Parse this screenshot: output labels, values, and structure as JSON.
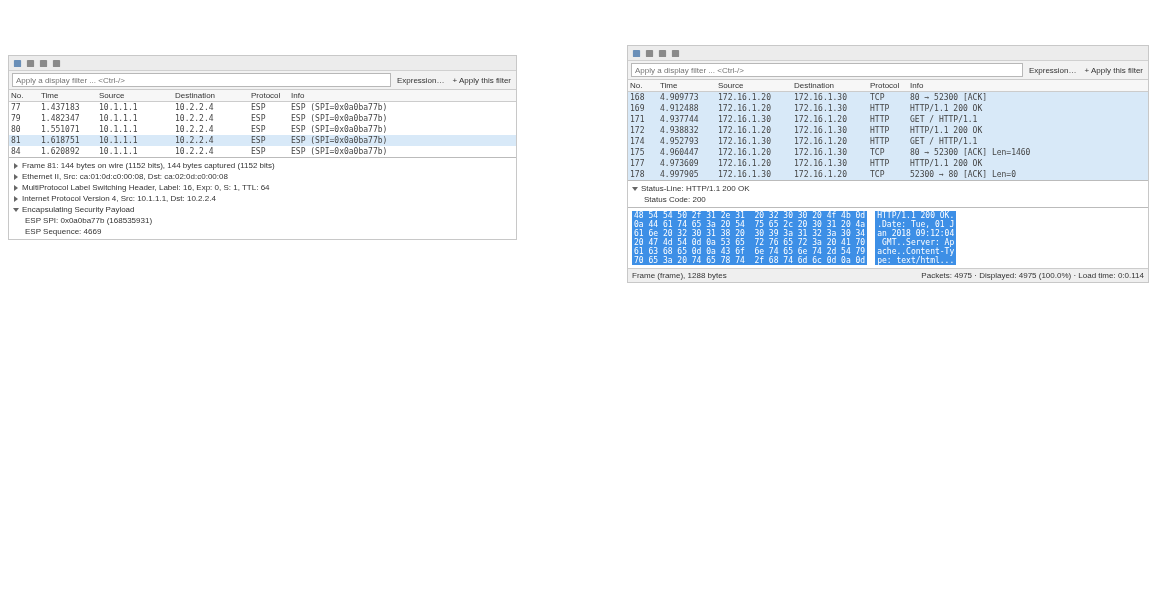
{
  "windows": [
    {
      "filter": {
        "placeholder": "Apply a display filter ... <Ctrl-/>"
      },
      "filter_buttons": [
        "Expression…",
        "+ Apply this filter"
      ],
      "columns": [
        "No.",
        "Time",
        "Source",
        "Destination",
        "Protocol",
        "Info"
      ],
      "rows": [
        {
          "no": "77",
          "time": "1.437183",
          "source": "10.1.1.1",
          "destination": "10.2.2.4",
          "protocol": "ESP",
          "info": "ESP (SPI=0x0a0ba77b)",
          "selected": false
        },
        {
          "no": "79",
          "time": "1.482347",
          "source": "10.1.1.1",
          "destination": "10.2.2.4",
          "protocol": "ESP",
          "info": "ESP (SPI=0x0a0ba77b)",
          "selected": false
        },
        {
          "no": "80",
          "time": "1.551071",
          "source": "10.1.1.1",
          "destination": "10.2.2.4",
          "protocol": "ESP",
          "info": "ESP (SPI=0x0a0ba77b)",
          "selected": false
        },
        {
          "no": "81",
          "time": "1.618751",
          "source": "10.1.1.1",
          "destination": "10.2.2.4",
          "protocol": "ESP",
          "info": "ESP (SPI=0x0a0ba77b)",
          "selected": true
        },
        {
          "no": "84",
          "time": "1.620892",
          "source": "10.1.1.1",
          "destination": "10.2.2.4",
          "protocol": "ESP",
          "info": "ESP (SPI=0x0a0ba77b)",
          "selected": false
        }
      ],
      "details": [
        {
          "text": "Frame 81: 144 bytes on wire (1152 bits), 144 bytes captured (1152 bits)",
          "expanded": false
        },
        {
          "text": "Ethernet II, Src: ca:01:0d:c0:00:08, Dst: ca:02:0d:c0:00:08",
          "expanded": false
        },
        {
          "text": "MultiProtocol Label Switching Header, Label: 16, Exp: 0, S: 1, TTL: 64",
          "expanded": false
        },
        {
          "text": "Internet Protocol Version 4, Src: 10.1.1.1, Dst: 10.2.2.4",
          "expanded": false
        },
        {
          "text": "Encapsulating Security Payload",
          "expanded": true,
          "children": [
            "ESP SPI: 0x0a0ba77b (168535931)",
            "ESP Sequence: 4669"
          ]
        }
      ]
    },
    {
      "filter": {
        "placeholder": "Apply a display filter ... <Ctrl-/>"
      },
      "filter_buttons": [
        "Expression…",
        "+ Apply this filter"
      ],
      "columns": [
        "No.",
        "Time",
        "Source",
        "Destination",
        "Protocol",
        "Info"
      ],
      "rows": [
        {
          "no": "168",
          "time": "4.909773",
          "source": "172.16.1.20",
          "destination": "172.16.1.30",
          "protocol": "TCP",
          "info": "80 → 52300 [ACK]",
          "selected": true
        },
        {
          "no": "169",
          "time": "4.912488",
          "source": "172.16.1.20",
          "destination": "172.16.1.30",
          "protocol": "HTTP",
          "info": "HTTP/1.1 200 OK",
          "selected": true
        },
        {
          "no": "171",
          "time": "4.937744",
          "source": "172.16.1.30",
          "destination": "172.16.1.20",
          "protocol": "HTTP",
          "info": "GET / HTTP/1.1",
          "selected": true
        },
        {
          "no": "172",
          "time": "4.938832",
          "source": "172.16.1.20",
          "destination": "172.16.1.30",
          "protocol": "HTTP",
          "info": "HTTP/1.1 200 OK",
          "selected": true
        },
        {
          "no": "174",
          "time": "4.952793",
          "source": "172.16.1.30",
          "destination": "172.16.1.20",
          "protocol": "HTTP",
          "info": "GET / HTTP/1.1",
          "selected": true
        },
        {
          "no": "175",
          "time": "4.960447",
          "source": "172.16.1.20",
          "destination": "172.16.1.30",
          "protocol": "TCP",
          "info": "80 → 52300 [ACK] Len=1460",
          "selected": true
        },
        {
          "no": "177",
          "time": "4.973609",
          "source": "172.16.1.20",
          "destination": "172.16.1.30",
          "protocol": "HTTP",
          "info": "HTTP/1.1 200 OK",
          "selected": true
        },
        {
          "no": "178",
          "time": "4.997905",
          "source": "172.16.1.30",
          "destination": "172.16.1.20",
          "protocol": "TCP",
          "info": "52300 → 80 [ACK] Len=0",
          "selected": true
        }
      ],
      "details": [
        {
          "text": "Status-Line: HTTP/1.1 200 OK",
          "expanded": true,
          "children": [
            "Status Code: 200"
          ]
        }
      ],
      "hex": [
        "48 54 54 50 2f 31 2e 31  20 32 30 30 20 4f 4b 0d",
        "0a 44 61 74 65 3a 20 54  75 65 2c 20 30 31 20 4a",
        "61 6e 20 32 30 31 38 20  30 39 3a 31 32 3a 30 34",
        "20 47 4d 54 0d 0a 53 65  72 76 65 72 3a 20 41 70",
        "61 63 68 65 0d 0a 43 6f  6e 74 65 6e 74 2d 54 79",
        "70 65 3a 20 74 65 78 74  2f 68 74 6d 6c 0d 0a 0d"
      ],
      "ascii": [
        "HTTP/1.1 200 OK.",
        ".Date: Tue, 01 J",
        "an 2018 09:12:04",
        " GMT..Server: Ap",
        "ache..Content-Ty",
        "pe: text/html..."
      ],
      "status": {
        "left": "Frame (frame), 1288 bytes",
        "right": "Packets: 4975 · Displayed: 4975 (100.0%) · Load time: 0:0.114"
      }
    }
  ]
}
